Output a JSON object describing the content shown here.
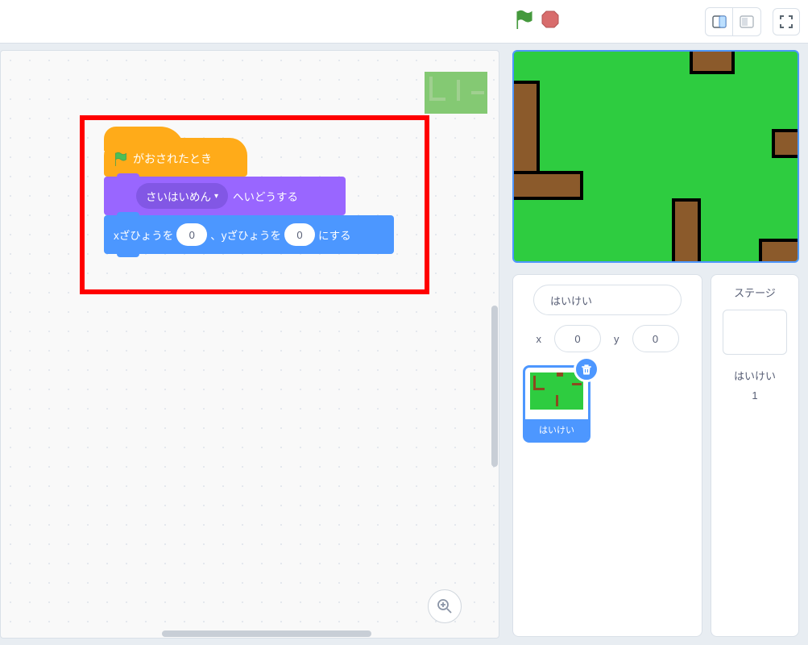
{
  "blocks": {
    "hat_label": "がおされたとき",
    "purple_dropdown": "さいはいめん",
    "purple_suffix": "へいどうする",
    "blue_prefix_x": "xざひょうを",
    "blue_value_x": "0",
    "blue_mid": "、yざひょうを",
    "blue_value_y": "0",
    "blue_suffix": "にする"
  },
  "sprite_panel": {
    "name": "はいけい",
    "x_label": "x",
    "x_value": "0",
    "y_label": "y",
    "y_value": "0",
    "card_label": "はいけい"
  },
  "stage_panel": {
    "title": "ステージ",
    "backdrop_label": "はいけい",
    "backdrop_count": "1"
  }
}
